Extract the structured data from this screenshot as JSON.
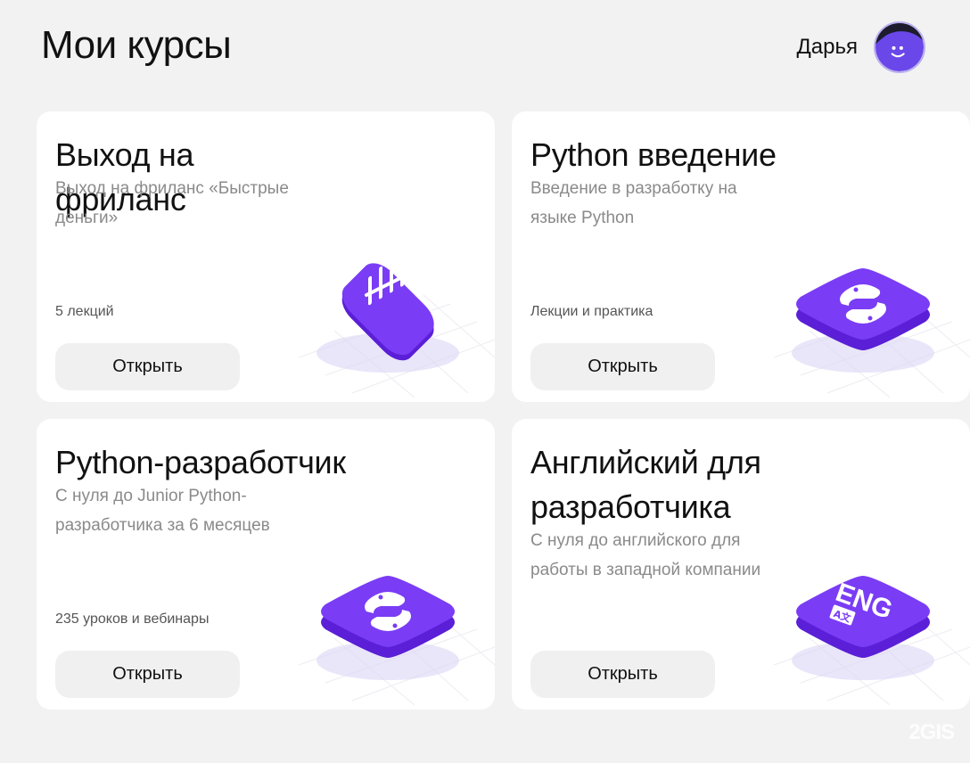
{
  "header": {
    "title": "Мои курсы",
    "user_name": "Дарья"
  },
  "courses": [
    {
      "title": "Выход на фриланс",
      "description": "Выход на фриланс «Быстрые деньги»",
      "meta": "5 лекций",
      "button": "Открыть",
      "icon": "bars-icon"
    },
    {
      "title": "Python введение",
      "description": "Введение в разработку на языке Python",
      "meta": "Лекции и практика",
      "button": "Открыть",
      "icon": "python-icon"
    },
    {
      "title": "Python-разработчик",
      "description": "С нуля до Junior Python-разработчика за 6 месяцев",
      "meta": "235 уроков и вебинары",
      "button": "Открыть",
      "icon": "python-icon"
    },
    {
      "title": "Английский для разработчика",
      "description": "С нуля до английского для работы в западной компании",
      "meta": "",
      "button": "Открыть",
      "icon": "eng-icon",
      "icon_text": "ENG",
      "icon_subtext": "A文"
    }
  ],
  "watermark": "2GIS",
  "colors": {
    "accent": "#7a3cf5",
    "background": "#f2f2f2",
    "card": "#ffffff"
  }
}
